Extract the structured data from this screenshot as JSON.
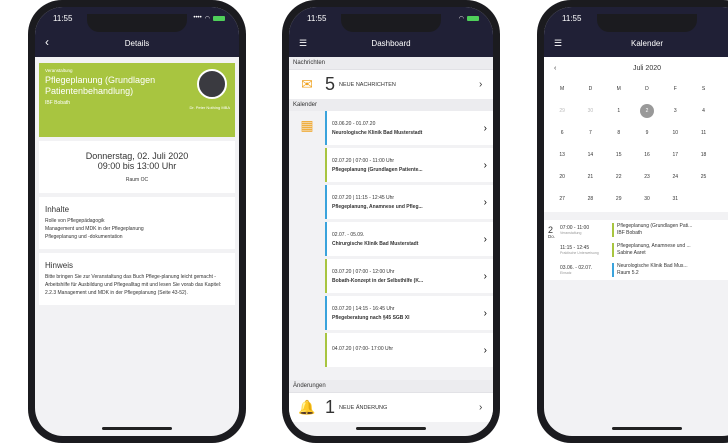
{
  "status": {
    "time": "11:55"
  },
  "p1": {
    "title": "Details",
    "kind": "Veranstaltung",
    "event": "Pflegeplanung (Grundlagen Patientenbehandlung)",
    "org": "IBF Bobath",
    "person": "Dr. Peter Nothing MBA",
    "date": "Donnerstag, 02. Juli 2020",
    "hours": "09:00 bis 13:00 Uhr",
    "room": "Raum OC",
    "s1h": "Inhalte",
    "s1b": "Rolle von Pflegepädagogik\nManagement und MDK in der Pflegeplanung\nPflegeplanung und -dokumentation",
    "s2h": "Hinweis",
    "s2b": "Bitte bringen Sie zur Veranstaltung das Buch Pflege-planung leicht gemacht - Arbeitshilfe für Ausbildung und Pflegealltag mit und lesen Sie vorab das Kapitel: 2.2.3 Management und MDK in der Pflegeplanung (Seite 43-52)."
  },
  "p2": {
    "title": "Dashboard",
    "l1": "Nachrichten",
    "n": "5",
    "nt": "NEUE NACHRICHTEN",
    "l2": "Kalender",
    "items": [
      {
        "a": "03.06.20 - 01.07.20",
        "b": "Neurologische Klinik Bad Musterstadt"
      },
      {
        "a": "02.07.20 | 07:00 - 11:00 Uhr",
        "b": "Pflegeplanung (Grundlagen Patiente..."
      },
      {
        "a": "02.07.20 | 11:15 - 12:45 Uhr",
        "b": "Pflegeplanung, Anamnese und Pfleg..."
      },
      {
        "a": "02.07. - 05.09.",
        "b": "Chirurgische Klinik Bad Musterstadt"
      },
      {
        "a": "03.07.20 | 07:00 - 12:00 Uhr",
        "b": "Bobath-Konzept in der Selbsthilfe (K..."
      },
      {
        "a": "03.07.20 | 14:15 - 16:45 Uhr",
        "b": "Pflegeberatung nach §45 SGB XI"
      },
      {
        "a": "04.07.20 | 07:00- 17:00 Uhr",
        "b": ""
      }
    ],
    "l3": "Änderungen",
    "c": "1",
    "ct": "NEUE ÄNDERUNG"
  },
  "p3": {
    "title": "Kalender",
    "month": "Juli 2020",
    "days": [
      "M",
      "D",
      "M",
      "D",
      "F",
      "S",
      "S"
    ],
    "cells": [
      "29",
      "30",
      "1",
      "2",
      "3",
      "4",
      "5",
      "6",
      "7",
      "8",
      "9",
      "10",
      "11",
      "12",
      "13",
      "14",
      "15",
      "16",
      "17",
      "18",
      "19",
      "20",
      "21",
      "22",
      "23",
      "24",
      "25",
      "26",
      "27",
      "28",
      "29",
      "30",
      "31",
      "",
      ""
    ],
    "daynum": "2",
    "dayname": "Do.",
    "ag": [
      {
        "t": "07:00 - 11:00",
        "s": "Veranstaltung",
        "e": "Pflegeplanung (Grundlagen Pati...",
        "e2": "IBF Bobath"
      },
      {
        "t": "11:15 - 12:45",
        "s": "Praktische Unterweisung",
        "e": "Pflegeplanung, Anamnese und ...",
        "e2": "Sabine Aaret"
      },
      {
        "t": "03.06. - 02.07.",
        "s": "Einsatz",
        "e": "Neurologische Klinik Bad Mus...",
        "e2": "Raum 5.2"
      }
    ]
  }
}
